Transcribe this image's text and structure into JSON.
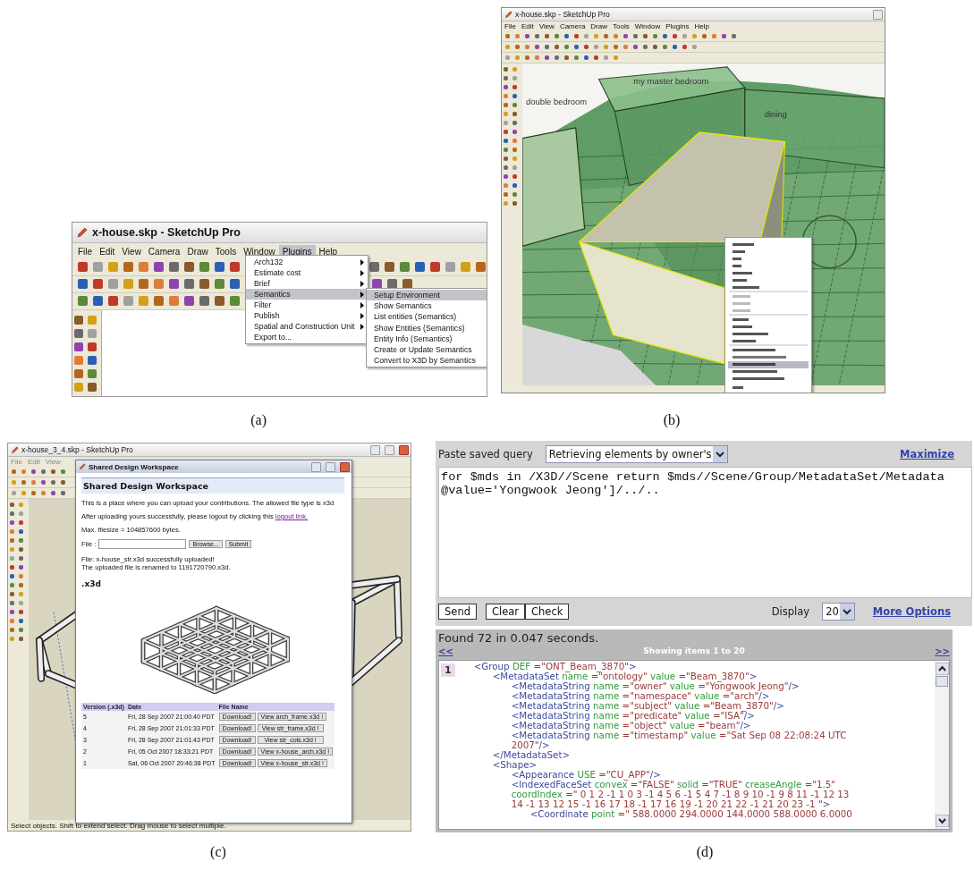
{
  "panel_a": {
    "caption": "(a)",
    "window_title": "x-house.skp - SketchUp Pro",
    "menu_bar": [
      {
        "label": "File",
        "selected": false
      },
      {
        "label": "Edit",
        "selected": false
      },
      {
        "label": "View",
        "selected": false
      },
      {
        "label": "Camera",
        "selected": false
      },
      {
        "label": "Draw",
        "selected": false
      },
      {
        "label": "Tools",
        "selected": false
      },
      {
        "label": "Window",
        "selected": false
      },
      {
        "label": "Plugins",
        "selected": true
      },
      {
        "label": "Help",
        "selected": false
      }
    ],
    "menu": [
      {
        "label": "Arch132",
        "submenu": true,
        "selected": false
      },
      {
        "label": "Estimate cost",
        "submenu": true,
        "selected": false
      },
      {
        "label": "Brief",
        "submenu": true,
        "selected": false
      },
      {
        "label": "Semantics",
        "submenu": true,
        "selected": true
      },
      {
        "label": "Filter",
        "submenu": true,
        "selected": false
      },
      {
        "label": "Publish",
        "submenu": true,
        "selected": false
      },
      {
        "label": "Spatial and Construction Unit",
        "submenu": true,
        "selected": false
      },
      {
        "label": "Export to...",
        "submenu": false,
        "selected": false
      }
    ],
    "submenu": [
      {
        "label": "Setup Environment",
        "selected": true
      },
      {
        "label": "Show Semantics",
        "selected": false
      },
      {
        "label": "List entities (Semantics)",
        "selected": false
      },
      {
        "label": "Show Entities (Semantics)",
        "selected": false
      },
      {
        "label": "Entity Info (Semantics)",
        "selected": false
      },
      {
        "label": "Create or Update Semantics",
        "selected": false
      },
      {
        "label": "Convert to X3D by Semantics",
        "selected": false
      }
    ]
  },
  "panel_b": {
    "caption": "(b)",
    "window_title": "x-house.skp - SketchUp Pro",
    "menu_bar": [
      "File",
      "Edit",
      "View",
      "Camera",
      "Draw",
      "Tools",
      "Window",
      "Plugins",
      "Help"
    ],
    "room_labels": [
      "my master bedroom",
      "dining",
      "double bedroom"
    ]
  },
  "panel_c": {
    "caption": "(c)",
    "window_title": "x-house_3_4.skp - SketchUp Pro",
    "menu_bar": [
      "File",
      "Edit",
      "View"
    ],
    "status_text": "Select objects. Shift to extend select. Drag mouse to select multiple.",
    "dialog": {
      "title": "Shared Design Workspace",
      "heading": "Shared Design Workspace",
      "intro": "This is a place where you can upload your contributions. The allowed file type is x3d",
      "logout_text": "After uploading yours successfully, please logout by clicking this",
      "logout_link": "logout link.",
      "max_size": "Max. filesize = 104857600 bytes.",
      "file_label": "File :",
      "browse_button": "Browse...",
      "submit_button": "Submit",
      "upload_messages": [
        "File: x-house_str.x3d successfully uploaded!",
        "The uploaded file is renamed to 1191720790.x3d."
      ],
      "preview_heading": ".x3d",
      "columns": [
        "Version (.x3d)",
        "Date",
        "File Name"
      ],
      "rows": [
        {
          "version": "5",
          "date": "Fri, 28 Sep 2007 21:00:40 PDT",
          "download": "Download!",
          "view": "View arch_frame.x3d !"
        },
        {
          "version": "4",
          "date": "Fri, 28 Sep 2007 21:01:33 PDT",
          "download": "Download!",
          "view": "View str_frame.x3d !"
        },
        {
          "version": "3",
          "date": "Fri, 28 Sep 2007 21:01:43 PDT",
          "download": "Download!",
          "view": "View str_cols.x3d !"
        },
        {
          "version": "2",
          "date": "Fri, 05 Oct 2007 18:33:21 PDT",
          "download": "Download!",
          "view": "View x-house_arch.x3d !"
        },
        {
          "version": "1",
          "date": "Sat, 06 Oct 2007 20:46:38 PDT",
          "download": "Download!",
          "view": "View x-house_str.x3d !"
        }
      ]
    }
  },
  "panel_d": {
    "caption": "(d)",
    "saved_query_label": "Paste saved query",
    "saved_query": "Retrieving elements by owner's",
    "maximize_link": "Maximize",
    "query_lines": [
      "for $mds in /X3D//Scene return $mds//Scene/Group/MetadataSet/Metadata",
      "@value='Yongwook Jeong']/../.."
    ],
    "buttons": [
      "Send",
      "Clear",
      "Check"
    ],
    "display_label": "Display",
    "display_value": "20",
    "more_options_link": "More Options",
    "found_text": "Found 72 in 0.047 seconds.",
    "prev_link": "<<",
    "showing_text": "Showing items 1 to 20",
    "next_link": ">>",
    "result_number": "1",
    "xml": [
      {
        "lines": [
          [
            {
              "kind": "tag",
              "text": "<Group"
            },
            {
              "kind": "attr",
              "text": " DEF"
            },
            {
              "kind": "value",
              "text": " =\"ONT_Beam_3870\""
            },
            {
              "kind": "tag",
              "text": ">"
            }
          ]
        ],
        "children": [
          {
            "lines": [
              [
                {
                  "kind": "tag",
                  "text": "<MetadataSet"
                },
                {
                  "kind": "attr",
                  "text": " name"
                },
                {
                  "kind": "value",
                  "text": " =\"ontology\""
                },
                {
                  "kind": "attr",
                  "text": " value"
                },
                {
                  "kind": "value",
                  "text": " =\"Beam_3870\""
                },
                {
                  "kind": "tag",
                  "text": ">"
                }
              ]
            ],
            "children": [
              {
                "lines": [
                  [
                    {
                      "kind": "tag",
                      "text": "<MetadataString"
                    },
                    {
                      "kind": "attr",
                      "text": " name"
                    },
                    {
                      "kind": "value",
                      "text": " =\"owner\""
                    },
                    {
                      "kind": "attr",
                      "text": " value"
                    },
                    {
                      "kind": "value",
                      "text": " =\"Yongwook Jeong\""
                    },
                    {
                      "kind": "tag",
                      "text": "/>"
                    }
                  ]
                ]
              },
              {
                "lines": [
                  [
                    {
                      "kind": "tag",
                      "text": "<MetadataString"
                    },
                    {
                      "kind": "attr",
                      "text": " name"
                    },
                    {
                      "kind": "value",
                      "text": " =\"namespace\""
                    },
                    {
                      "kind": "attr",
                      "text": " value"
                    },
                    {
                      "kind": "value",
                      "text": " =\"arch\""
                    },
                    {
                      "kind": "tag",
                      "text": "/>"
                    }
                  ]
                ]
              },
              {
                "lines": [
                  [
                    {
                      "kind": "tag",
                      "text": "<MetadataString"
                    },
                    {
                      "kind": "attr",
                      "text": " name"
                    },
                    {
                      "kind": "value",
                      "text": " =\"subject\""
                    },
                    {
                      "kind": "attr",
                      "text": " value"
                    },
                    {
                      "kind": "value",
                      "text": " =\"Beam_3870\""
                    },
                    {
                      "kind": "tag",
                      "text": "/>"
                    }
                  ]
                ]
              },
              {
                "lines": [
                  [
                    {
                      "kind": "tag",
                      "text": "<MetadataString"
                    },
                    {
                      "kind": "attr",
                      "text": " name"
                    },
                    {
                      "kind": "value",
                      "text": " =\"predicate\""
                    },
                    {
                      "kind": "attr",
                      "text": " value"
                    },
                    {
                      "kind": "value",
                      "text": " =\"ISA\""
                    },
                    {
                      "kind": "tag",
                      "text": "/>"
                    }
                  ]
                ]
              },
              {
                "lines": [
                  [
                    {
                      "kind": "tag",
                      "text": "<MetadataString"
                    },
                    {
                      "kind": "attr",
                      "text": " name"
                    },
                    {
                      "kind": "value",
                      "text": " =\"object\""
                    },
                    {
                      "kind": "attr",
                      "text": " value"
                    },
                    {
                      "kind": "value",
                      "text": " =\"beam\""
                    },
                    {
                      "kind": "tag",
                      "text": "/>"
                    }
                  ]
                ]
              },
              {
                "lines": [
                  [
                    {
                      "kind": "tag",
                      "text": "<MetadataString"
                    },
                    {
                      "kind": "attr",
                      "text": " name"
                    },
                    {
                      "kind": "value",
                      "text": " =\"timestamp\""
                    },
                    {
                      "kind": "attr",
                      "text": " value"
                    },
                    {
                      "kind": "value",
                      "text": " =\"Sat Sep 08 22:08:24 UTC"
                    }
                  ],
                  [
                    {
                      "kind": "value",
                      "text": "2007\""
                    },
                    {
                      "kind": "tag",
                      "text": "/>"
                    }
                  ]
                ]
              }
            ],
            "close": [
              {
                "kind": "tag",
                "text": "</MetadataSet>"
              }
            ]
          },
          {
            "lines": [
              [
                {
                  "kind": "tag",
                  "text": "<Shape>"
                }
              ]
            ],
            "children": [
              {
                "lines": [
                  [
                    {
                      "kind": "tag",
                      "text": "<Appearance"
                    },
                    {
                      "kind": "attr",
                      "text": " USE"
                    },
                    {
                      "kind": "value",
                      "text": " =\"CU_APP\""
                    },
                    {
                      "kind": "tag",
                      "text": "/>"
                    }
                  ]
                ]
              },
              {
                "lines": [
                  [
                    {
                      "kind": "tag",
                      "text": "<IndexedFaceSet"
                    },
                    {
                      "kind": "attr",
                      "text": " convex"
                    },
                    {
                      "kind": "value",
                      "text": " =\"FALSE\""
                    },
                    {
                      "kind": "attr",
                      "text": " solid"
                    },
                    {
                      "kind": "value",
                      "text": " =\"TRUE\""
                    },
                    {
                      "kind": "attr",
                      "text": " creaseAngle"
                    },
                    {
                      "kind": "value",
                      "text": " =\"1.5\""
                    }
                  ],
                  [
                    {
                      "kind": "attr",
                      "text": "coordIndex"
                    },
                    {
                      "kind": "value",
                      "text": " =\" 0 1 2 -1 1 0 3 -1 4 5 6 -1 5 4 7 -1 8 9 10 -1 9 8 11 -1 12 13"
                    }
                  ],
                  [
                    {
                      "kind": "value",
                      "text": "14 -1 13 12 15 -1 16 17 18 -1 17 16 19 -1 20 21 22 -1 21 20 23 -1 \""
                    },
                    {
                      "kind": "tag",
                      "text": ">"
                    }
                  ]
                ],
                "children": [
                  {
                    "lines": [
                      [
                        {
                          "kind": "tag",
                          "text": "<Coordinate"
                        },
                        {
                          "kind": "attr",
                          "text": " point"
                        },
                        {
                          "kind": "value",
                          "text": " =\" 588.0000 294.0000 144.0000 588.0000 6.0000"
                        }
                      ]
                    ]
                  }
                ]
              }
            ]
          }
        ]
      }
    ]
  }
}
